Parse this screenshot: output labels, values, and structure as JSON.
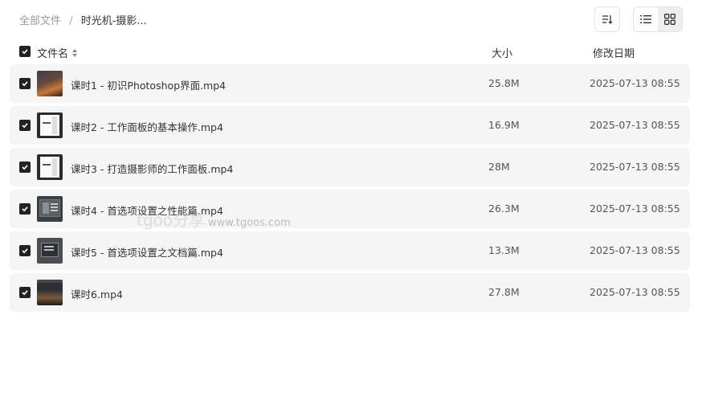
{
  "breadcrumb": {
    "root": "全部文件",
    "separator": "/",
    "current": "时光机-摄影..."
  },
  "toolbar": {
    "sort_icon": "sort-icon",
    "list_view_icon": "list-view-icon",
    "grid_view_icon": "grid-view-icon",
    "active_view": "list"
  },
  "table": {
    "headers": {
      "name": "文件名",
      "size": "大小",
      "date": "修改日期"
    },
    "rows": [
      {
        "name": "课时1 - 初识Photoshop界面.mp4",
        "size": "25.8M",
        "date": "2025-07-13 08:55",
        "checked": true,
        "thumb": "photo"
      },
      {
        "name": "课时2 - 工作面板的基本操作.mp4",
        "size": "16.9M",
        "date": "2025-07-13 08:55",
        "checked": true,
        "thumb": "doc"
      },
      {
        "name": "课时3 - 打造摄影师的工作面板.mp4",
        "size": "28M",
        "date": "2025-07-13 08:55",
        "checked": true,
        "thumb": "doc"
      },
      {
        "name": "课时4 - 首选项设置之性能篇.mp4",
        "size": "26.3M",
        "date": "2025-07-13 08:55",
        "checked": true,
        "thumb": "dialog"
      },
      {
        "name": "课时5 - 首选项设置之文档篇.mp4",
        "size": "13.3M",
        "date": "2025-07-13 08:55",
        "checked": true,
        "thumb": "dialog2"
      },
      {
        "name": "课时6.mp4",
        "size": "27.8M",
        "date": "2025-07-13 08:55",
        "checked": true,
        "thumb": "ps"
      }
    ]
  },
  "watermark": {
    "brand": "tgoo分享",
    "url": "www.tgoos.com"
  },
  "colors": {
    "row_bg": "#f5f5f6",
    "checkbox": "#222222",
    "muted_text": "#999999"
  }
}
